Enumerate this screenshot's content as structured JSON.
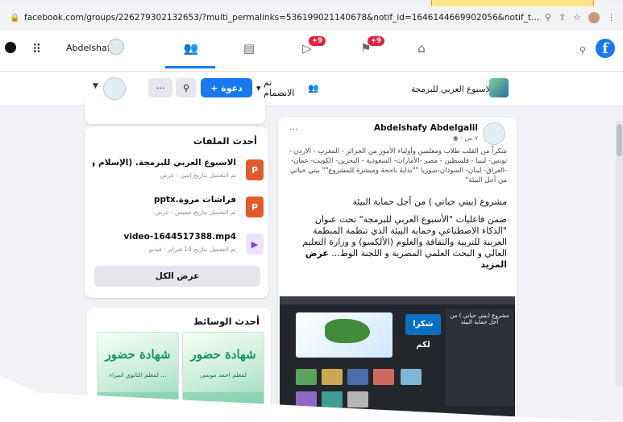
{
  "browser": {
    "url": "facebook.com/groups/226279302132653/?multi_permalinks=536199021140678&notif_id=1646144669902056&notif_t=feedback_reaction_generic&ref...",
    "icons": [
      "lock-icon",
      "zoom-icon",
      "share-icon",
      "star-icon"
    ]
  },
  "navbar": {
    "user_name": "Abdelshafy",
    "badges": {
      "watch": "+9",
      "marketplace": "+9"
    }
  },
  "group_bar": {
    "group_name": "الاسبوع العربي للبرمجة",
    "joined_label": "تم الانضمام",
    "invite_label": "+ دعوة",
    "more_label": "···"
  },
  "files": {
    "title": "أحدث الملفات",
    "items": [
      {
        "name": "الاسبوع العربي للبرمجة. (الإسلام والب...",
        "meta": "تم التحميل بتاريخ إثنين · عرض",
        "type": "P"
      },
      {
        "name": "فراشات مروة.pptx",
        "meta": "تم التحميل بتاريخ خميس · عرض",
        "type": "P"
      },
      {
        "name": "video-1644517388.mp4",
        "meta": "تم التحميل بتاريخ 14 فبراير · فيديو",
        "type": "▶"
      }
    ],
    "see_all": "عرض الكل"
  },
  "media": {
    "title": "أحدث الوسائط",
    "cert_title": "شهادة حضور",
    "cert_sub_1": "لمعلم الثانوي اسراء ...",
    "cert_sub_2": "لمعلم احمد موسى"
  },
  "post": {
    "more": "···",
    "author": "Abdelshafy Abdelgalil",
    "time": "٧ س · ◉",
    "thanks": "شكراً من القلب طلاب ومعلمين وأولياء الأمور من الجزائر - المغرب - الاردن - تونس- ليبيا - فلسطين - مصر -الأمارات- السعودية - البحرين- الكويت- عمان- -العراق- لبنان- السودان-سوريا \"\"بداية ناجحة ومبشرة للمشروع\"\" بيتي حياتي من أجل البيئة\"",
    "project": "مشروع (بيتي حياتي ) من أجل حماية البيئة",
    "body": "ضمن فاعليات \"الأسبوع العربي للبرمجة\" تحت عنوان \"الذكاء الاصطناعي وحماية البيئة الذي تنظمة المنظمة العربية للتربية والثقافة والعلوم (الألكسو) و وزارة التعليم العالي و البحث العلمي المصرية و اللجنة الوط...",
    "more_link": "عرض المزيد",
    "media_thanks": "شكرا لكم",
    "media_screen_title": "مشروع (بيتي حياتي ) من أجل حماية البيئة"
  },
  "colors": {
    "fb_blue": "#1877f2",
    "badge_red": "#e41e3f",
    "ppt": "#e25a2c"
  }
}
